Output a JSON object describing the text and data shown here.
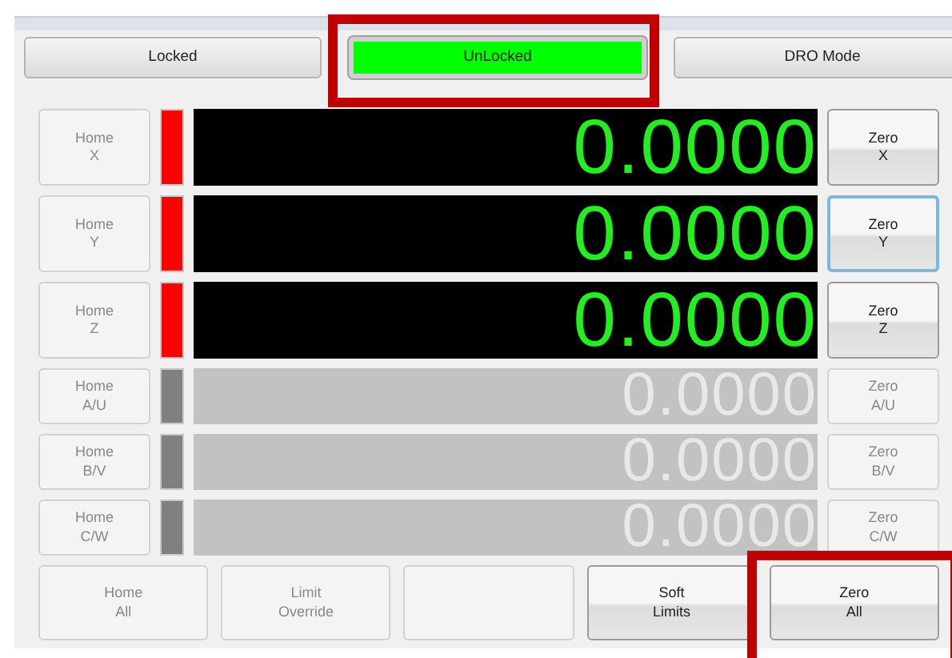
{
  "mode_buttons": [
    {
      "label": "Locked",
      "active": false,
      "highlighted": false
    },
    {
      "label": "UnLocked",
      "active": true,
      "highlighted": true
    },
    {
      "label": "DRO Mode",
      "active": false,
      "highlighted": false
    }
  ],
  "axes": [
    {
      "home": "Home\nX",
      "value": "0.0000",
      "zero": "Zero\nX",
      "enabled": true,
      "focused": false
    },
    {
      "home": "Home\nY",
      "value": "0.0000",
      "zero": "Zero\nY",
      "enabled": true,
      "focused": true
    },
    {
      "home": "Home\nZ",
      "value": "0.0000",
      "zero": "Zero\nZ",
      "enabled": true,
      "focused": false
    },
    {
      "home": "Home\nA/U",
      "value": "0.0000",
      "zero": "Zero\nA/U",
      "enabled": false,
      "focused": false
    },
    {
      "home": "Home\nB/V",
      "value": "0.0000",
      "zero": "Zero\nB/V",
      "enabled": false,
      "focused": false
    },
    {
      "home": "Home\nC/W",
      "value": "0.0000",
      "zero": "Zero\nC/W",
      "enabled": false,
      "focused": false
    }
  ],
  "bottom_buttons": [
    {
      "label": "Home\nAll",
      "enabled": false,
      "highlighted": false
    },
    {
      "label": "Limit\nOverride",
      "enabled": false,
      "highlighted": false
    },
    {
      "enabled": false,
      "highlighted": false
    },
    {
      "label": "Soft\nLimits",
      "enabled": true,
      "highlighted": false
    },
    {
      "label": "Zero\nAll",
      "enabled": true,
      "highlighted": true
    }
  ]
}
